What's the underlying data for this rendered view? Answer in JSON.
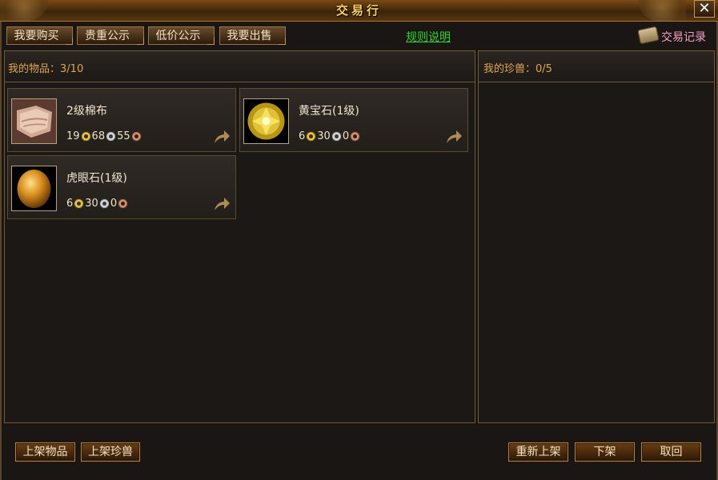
{
  "window": {
    "title": "交易行",
    "close_label": "✕"
  },
  "tabs": [
    {
      "label": "我要购买"
    },
    {
      "label": "贵重公示"
    },
    {
      "label": "低价公示"
    },
    {
      "label": "我要出售"
    }
  ],
  "rules_link": "规则说明",
  "history_label": "交易记录",
  "items_panel": {
    "header_label": "我的物品：",
    "count": "3/10",
    "items": [
      {
        "name": "2级棉布",
        "icon": "cloth-icon",
        "price": {
          "gold": "19",
          "silver": "68",
          "copper": "55"
        }
      },
      {
        "name": "黄宝石(1级)",
        "icon": "yellow-gem-icon",
        "price": {
          "gold": "6",
          "silver": "30",
          "copper": "0"
        }
      },
      {
        "name": "虎眼石(1级)",
        "icon": "tiger-eye-icon",
        "price": {
          "gold": "6",
          "silver": "30",
          "copper": "0"
        }
      }
    ]
  },
  "pets_panel": {
    "header_label": "我的珍兽：",
    "count": "0/5"
  },
  "bottom_buttons": {
    "list_items": "上架物品",
    "list_pets": "上架珍兽",
    "relist": "重新上架",
    "delist": "下架",
    "retrieve": "取回"
  },
  "colors": {
    "accent": "#e0a84e",
    "link": "#2dd62a",
    "history": "#f5a0c8",
    "title": "#ffd35a"
  }
}
